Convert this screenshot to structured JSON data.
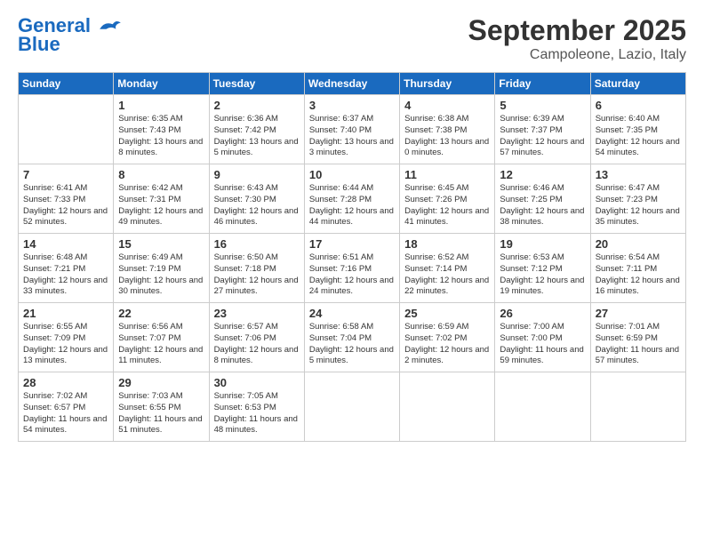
{
  "logo": {
    "line1": "General",
    "line2": "Blue"
  },
  "title": "September 2025",
  "location": "Campoleone, Lazio, Italy",
  "weekdays": [
    "Sunday",
    "Monday",
    "Tuesday",
    "Wednesday",
    "Thursday",
    "Friday",
    "Saturday"
  ],
  "weeks": [
    [
      {
        "day": "",
        "sunrise": "",
        "sunset": "",
        "daylight": ""
      },
      {
        "day": "1",
        "sunrise": "Sunrise: 6:35 AM",
        "sunset": "Sunset: 7:43 PM",
        "daylight": "Daylight: 13 hours and 8 minutes."
      },
      {
        "day": "2",
        "sunrise": "Sunrise: 6:36 AM",
        "sunset": "Sunset: 7:42 PM",
        "daylight": "Daylight: 13 hours and 5 minutes."
      },
      {
        "day": "3",
        "sunrise": "Sunrise: 6:37 AM",
        "sunset": "Sunset: 7:40 PM",
        "daylight": "Daylight: 13 hours and 3 minutes."
      },
      {
        "day": "4",
        "sunrise": "Sunrise: 6:38 AM",
        "sunset": "Sunset: 7:38 PM",
        "daylight": "Daylight: 13 hours and 0 minutes."
      },
      {
        "day": "5",
        "sunrise": "Sunrise: 6:39 AM",
        "sunset": "Sunset: 7:37 PM",
        "daylight": "Daylight: 12 hours and 57 minutes."
      },
      {
        "day": "6",
        "sunrise": "Sunrise: 6:40 AM",
        "sunset": "Sunset: 7:35 PM",
        "daylight": "Daylight: 12 hours and 54 minutes."
      }
    ],
    [
      {
        "day": "7",
        "sunrise": "Sunrise: 6:41 AM",
        "sunset": "Sunset: 7:33 PM",
        "daylight": "Daylight: 12 hours and 52 minutes."
      },
      {
        "day": "8",
        "sunrise": "Sunrise: 6:42 AM",
        "sunset": "Sunset: 7:31 PM",
        "daylight": "Daylight: 12 hours and 49 minutes."
      },
      {
        "day": "9",
        "sunrise": "Sunrise: 6:43 AM",
        "sunset": "Sunset: 7:30 PM",
        "daylight": "Daylight: 12 hours and 46 minutes."
      },
      {
        "day": "10",
        "sunrise": "Sunrise: 6:44 AM",
        "sunset": "Sunset: 7:28 PM",
        "daylight": "Daylight: 12 hours and 44 minutes."
      },
      {
        "day": "11",
        "sunrise": "Sunrise: 6:45 AM",
        "sunset": "Sunset: 7:26 PM",
        "daylight": "Daylight: 12 hours and 41 minutes."
      },
      {
        "day": "12",
        "sunrise": "Sunrise: 6:46 AM",
        "sunset": "Sunset: 7:25 PM",
        "daylight": "Daylight: 12 hours and 38 minutes."
      },
      {
        "day": "13",
        "sunrise": "Sunrise: 6:47 AM",
        "sunset": "Sunset: 7:23 PM",
        "daylight": "Daylight: 12 hours and 35 minutes."
      }
    ],
    [
      {
        "day": "14",
        "sunrise": "Sunrise: 6:48 AM",
        "sunset": "Sunset: 7:21 PM",
        "daylight": "Daylight: 12 hours and 33 minutes."
      },
      {
        "day": "15",
        "sunrise": "Sunrise: 6:49 AM",
        "sunset": "Sunset: 7:19 PM",
        "daylight": "Daylight: 12 hours and 30 minutes."
      },
      {
        "day": "16",
        "sunrise": "Sunrise: 6:50 AM",
        "sunset": "Sunset: 7:18 PM",
        "daylight": "Daylight: 12 hours and 27 minutes."
      },
      {
        "day": "17",
        "sunrise": "Sunrise: 6:51 AM",
        "sunset": "Sunset: 7:16 PM",
        "daylight": "Daylight: 12 hours and 24 minutes."
      },
      {
        "day": "18",
        "sunrise": "Sunrise: 6:52 AM",
        "sunset": "Sunset: 7:14 PM",
        "daylight": "Daylight: 12 hours and 22 minutes."
      },
      {
        "day": "19",
        "sunrise": "Sunrise: 6:53 AM",
        "sunset": "Sunset: 7:12 PM",
        "daylight": "Daylight: 12 hours and 19 minutes."
      },
      {
        "day": "20",
        "sunrise": "Sunrise: 6:54 AM",
        "sunset": "Sunset: 7:11 PM",
        "daylight": "Daylight: 12 hours and 16 minutes."
      }
    ],
    [
      {
        "day": "21",
        "sunrise": "Sunrise: 6:55 AM",
        "sunset": "Sunset: 7:09 PM",
        "daylight": "Daylight: 12 hours and 13 minutes."
      },
      {
        "day": "22",
        "sunrise": "Sunrise: 6:56 AM",
        "sunset": "Sunset: 7:07 PM",
        "daylight": "Daylight: 12 hours and 11 minutes."
      },
      {
        "day": "23",
        "sunrise": "Sunrise: 6:57 AM",
        "sunset": "Sunset: 7:06 PM",
        "daylight": "Daylight: 12 hours and 8 minutes."
      },
      {
        "day": "24",
        "sunrise": "Sunrise: 6:58 AM",
        "sunset": "Sunset: 7:04 PM",
        "daylight": "Daylight: 12 hours and 5 minutes."
      },
      {
        "day": "25",
        "sunrise": "Sunrise: 6:59 AM",
        "sunset": "Sunset: 7:02 PM",
        "daylight": "Daylight: 12 hours and 2 minutes."
      },
      {
        "day": "26",
        "sunrise": "Sunrise: 7:00 AM",
        "sunset": "Sunset: 7:00 PM",
        "daylight": "Daylight: 11 hours and 59 minutes."
      },
      {
        "day": "27",
        "sunrise": "Sunrise: 7:01 AM",
        "sunset": "Sunset: 6:59 PM",
        "daylight": "Daylight: 11 hours and 57 minutes."
      }
    ],
    [
      {
        "day": "28",
        "sunrise": "Sunrise: 7:02 AM",
        "sunset": "Sunset: 6:57 PM",
        "daylight": "Daylight: 11 hours and 54 minutes."
      },
      {
        "day": "29",
        "sunrise": "Sunrise: 7:03 AM",
        "sunset": "Sunset: 6:55 PM",
        "daylight": "Daylight: 11 hours and 51 minutes."
      },
      {
        "day": "30",
        "sunrise": "Sunrise: 7:05 AM",
        "sunset": "Sunset: 6:53 PM",
        "daylight": "Daylight: 11 hours and 48 minutes."
      },
      {
        "day": "",
        "sunrise": "",
        "sunset": "",
        "daylight": ""
      },
      {
        "day": "",
        "sunrise": "",
        "sunset": "",
        "daylight": ""
      },
      {
        "day": "",
        "sunrise": "",
        "sunset": "",
        "daylight": ""
      },
      {
        "day": "",
        "sunrise": "",
        "sunset": "",
        "daylight": ""
      }
    ]
  ]
}
